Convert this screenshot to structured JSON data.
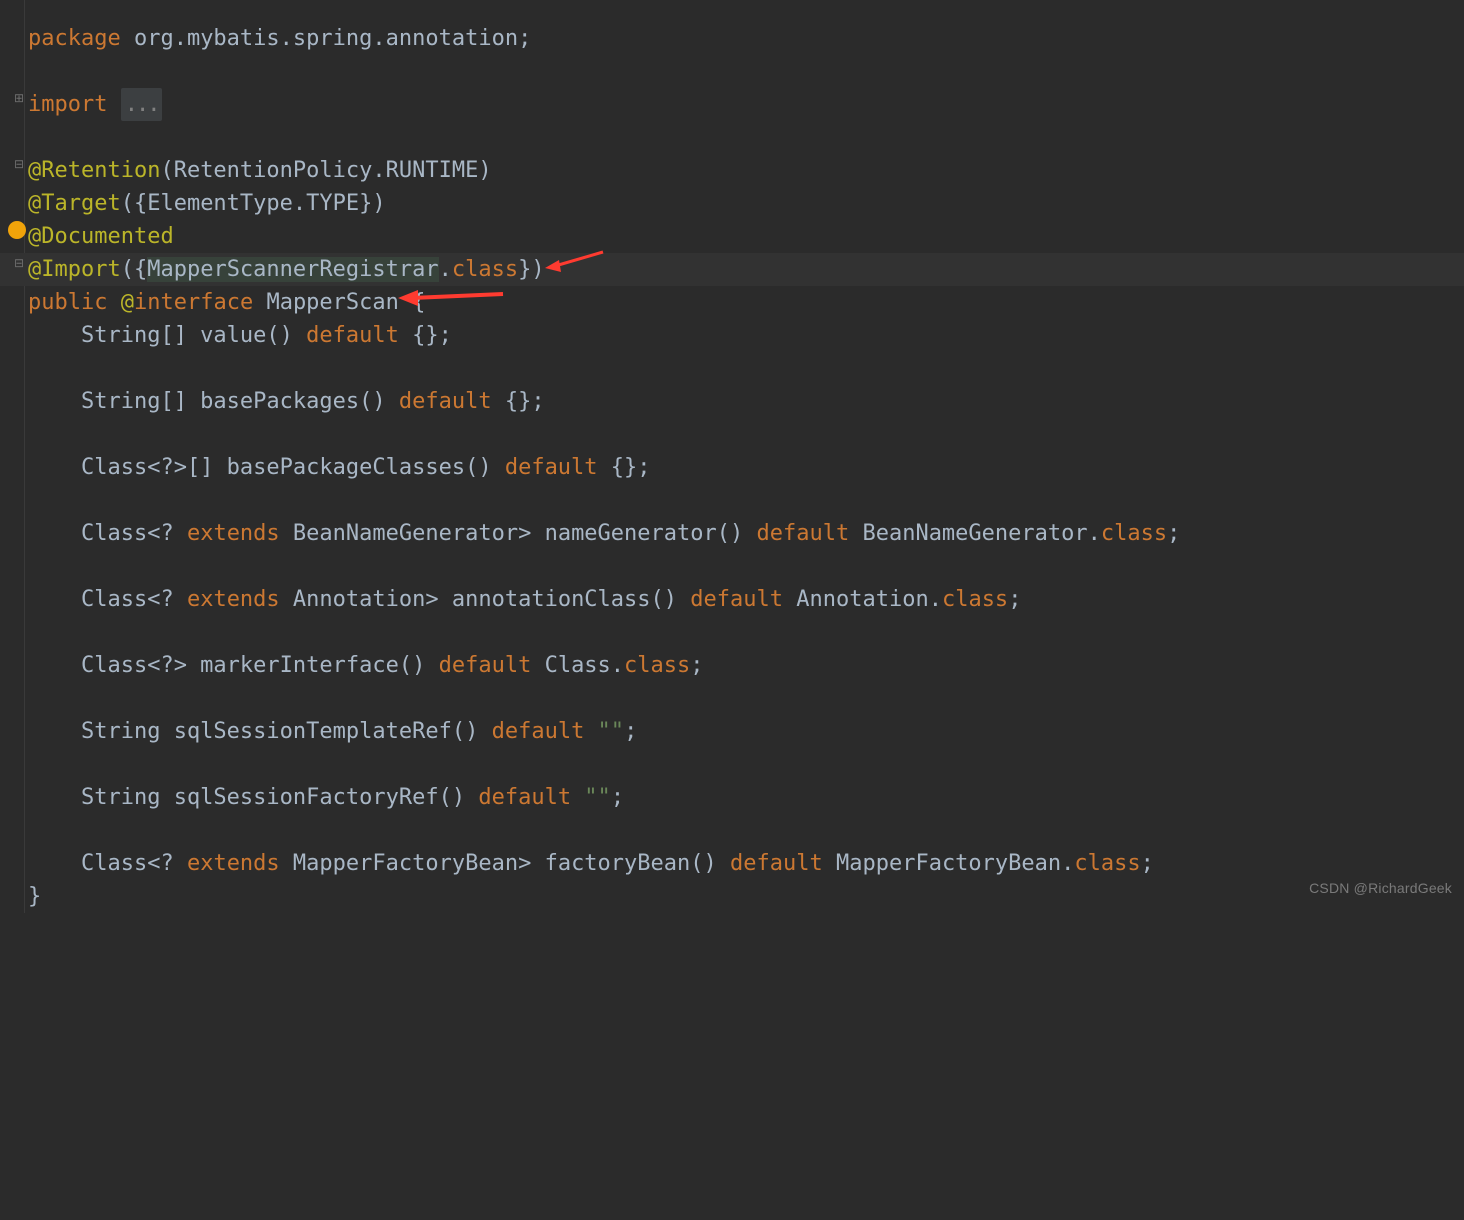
{
  "code": {
    "package_kw": "package",
    "package_name": " org.mybatis.spring.annotation;",
    "import_kw": "import",
    "import_fold": "...",
    "retention": "@Retention",
    "retention_args": "(RetentionPolicy.RUNTIME)",
    "target": "@Target",
    "target_args": "({ElementType.TYPE})",
    "documented": "@Documented",
    "import_ann": "@Import",
    "import_open": "({",
    "mapper_reg": "MapperScannerRegistrar",
    "dot": ".",
    "class_kw": "class",
    "import_close": "})",
    "public_kw": "public",
    "at": " @",
    "interface_kw": "interface",
    "class_name": " MapperScan {",
    "l_value": "    String[] value() ",
    "default_kw": "default",
    "l_value_end": " {};",
    "l_base": "    String[] basePackages() ",
    "l_base_end": " {};",
    "l_bpc": "    Class<?>[] basePackageClasses() ",
    "l_bpc_end": " {};",
    "l_ng_a": "    Class<? ",
    "extends_kw": "extends",
    "l_ng_b": " BeanNameGenerator> nameGenerator() ",
    "l_ng_c": " BeanNameGenerator.",
    "semi": ";",
    "l_ac_b": " Annotation> annotationClass() ",
    "l_ac_c": " Annotation.",
    "l_mi_a": "    Class<?> markerInterface() ",
    "l_mi_c": " Class.",
    "l_sstr": "    String sqlSessionTemplateRef() ",
    "empty_str": " \"\"",
    "l_ssfr": "    String sqlSessionFactoryRef() ",
    "l_fb_b": " MapperFactoryBean> factoryBean() ",
    "l_fb_c": " MapperFactoryBean.",
    "close": "}"
  },
  "footer": {
    "watermark": "CSDN @RichardGeek"
  }
}
